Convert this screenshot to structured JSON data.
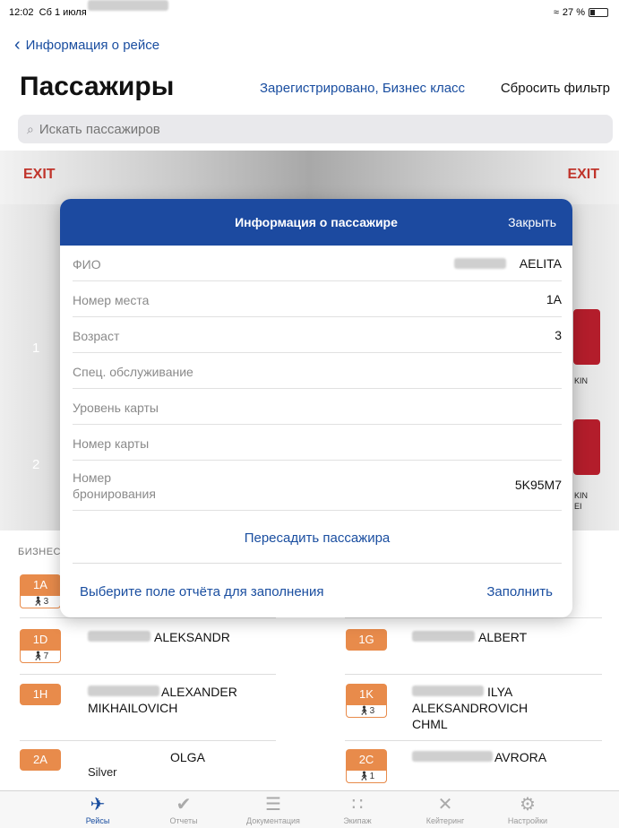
{
  "status": {
    "time": "12:02",
    "date": "Сб 1 июля",
    "wifi": "≈",
    "battery_text": "27 %",
    "battery_level": 0.27
  },
  "nav": {
    "back_label": "Информация о рейсе"
  },
  "header": {
    "title": "Пассажиры",
    "filter_label": "Зарегистрировано, Бизнес класс",
    "reset_label": "Сбросить фильтр"
  },
  "search": {
    "placeholder": "Искать пассажиров",
    "icon": "search-icon"
  },
  "cabin": {
    "exit_left": "EXIT",
    "exit_right": "EXIT",
    "rows": [
      "1",
      "2"
    ],
    "right_labels": [
      "KIN",
      "KIN",
      "EI"
    ]
  },
  "list": {
    "section_header": "БИЗНЕС",
    "passengers": [
      {
        "seat": "1A",
        "sub": "3"
      },
      {
        "seat": "1D",
        "sub": "7",
        "name": "ALEKSANDR"
      },
      {
        "seat": "1G",
        "name": "ALBERT"
      },
      {
        "seat": "1H",
        "name": "ALEXANDER",
        "name2": "MIKHAILOVICH"
      },
      {
        "seat": "1K",
        "sub": "3",
        "name": "ILYA",
        "name2": "ALEKSANDROVICH",
        "name3": "CHML"
      },
      {
        "seat": "2A",
        "name": "OLGA",
        "extra": "Silver"
      },
      {
        "seat": "2C",
        "sub": "1",
        "name": "AVRORA"
      }
    ]
  },
  "modal": {
    "title": "Информация о пассажире",
    "close_label": "Закрыть",
    "rows": [
      {
        "label": "ФИО",
        "value": "AELITA"
      },
      {
        "label": "Номер места",
        "value": "1A"
      },
      {
        "label": "Возраст",
        "value": "3"
      },
      {
        "label": "Спец. обслуживание",
        "value": ""
      },
      {
        "label": "Уровень карты",
        "value": ""
      },
      {
        "label": "Номер карты",
        "value": ""
      },
      {
        "label": "Номер\nбронирования",
        "value": "5K95M7"
      }
    ],
    "reseat_label": "Пересадить пассажира",
    "report_label": "Выберите поле отчёта для заполнения",
    "fill_label": "Заполнить"
  },
  "tabs": [
    {
      "label": "Рейсы",
      "icon": "plane-icon",
      "active": true
    },
    {
      "label": "Отчеты",
      "icon": "check-circle-icon"
    },
    {
      "label": "Документация",
      "icon": "document-icon"
    },
    {
      "label": "Экипаж",
      "icon": "crew-icon"
    },
    {
      "label": "Кейтеринг",
      "icon": "catering-icon"
    },
    {
      "label": "Настройки",
      "icon": "settings-icon"
    }
  ],
  "colors": {
    "accent": "#1c4aa0",
    "exit": "#c0342b",
    "seat_badge": "#e88b4b"
  }
}
